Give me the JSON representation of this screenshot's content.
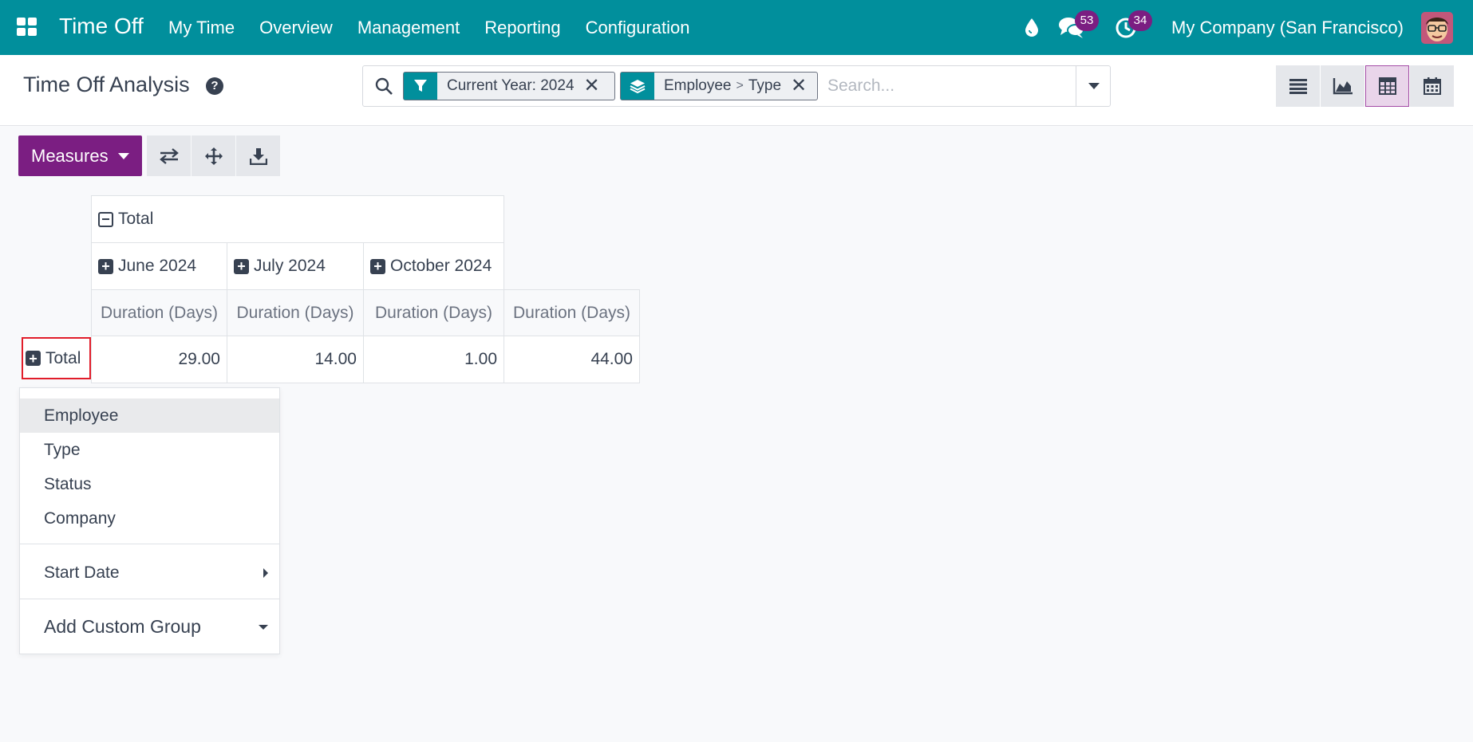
{
  "navbar": {
    "app_title": "Time Off",
    "menu": [
      "My Time",
      "Overview",
      "Management",
      "Reporting",
      "Configuration"
    ],
    "messages_count": "53",
    "activities_count": "34",
    "company": "My Company (San Francisco)",
    "icons": [
      "apps-grid-icon",
      "drop-icon",
      "chat-icon",
      "clock-icon"
    ]
  },
  "control_panel": {
    "page_title": "Time Off Analysis",
    "help_icon": "?",
    "facets": [
      {
        "icon": "filter-icon",
        "label": "Current Year: 2024"
      },
      {
        "icon": "layers-icon",
        "parts": [
          "Employee",
          "Type"
        ],
        "separator": ">"
      }
    ],
    "facet_close": "✕",
    "search_placeholder": "Search...",
    "views": [
      "list-view-icon",
      "graph-view-icon",
      "pivot-view-icon",
      "calendar-view-icon"
    ],
    "active_view": "pivot"
  },
  "actions": {
    "measures_label": "Measures",
    "tools": [
      "flip-axis-icon",
      "expand-all-icon",
      "download-icon"
    ]
  },
  "pivot": {
    "col_total_label": "Total",
    "columns": [
      "June 2024",
      "July 2024",
      "October 2024"
    ],
    "measure_label": "Duration (Days)",
    "row_total_label": "Total",
    "values": [
      "29.00",
      "14.00",
      "1.00",
      "44.00"
    ],
    "plus": "+"
  },
  "groupby_dropdown": {
    "items": [
      "Employee",
      "Type",
      "Status",
      "Company"
    ],
    "start_date": "Start Date",
    "custom_group": "Add Custom Group"
  },
  "colors": {
    "navbar": "#018f9c",
    "primary": "#7b1e82",
    "highlight": "#e11d2a"
  }
}
